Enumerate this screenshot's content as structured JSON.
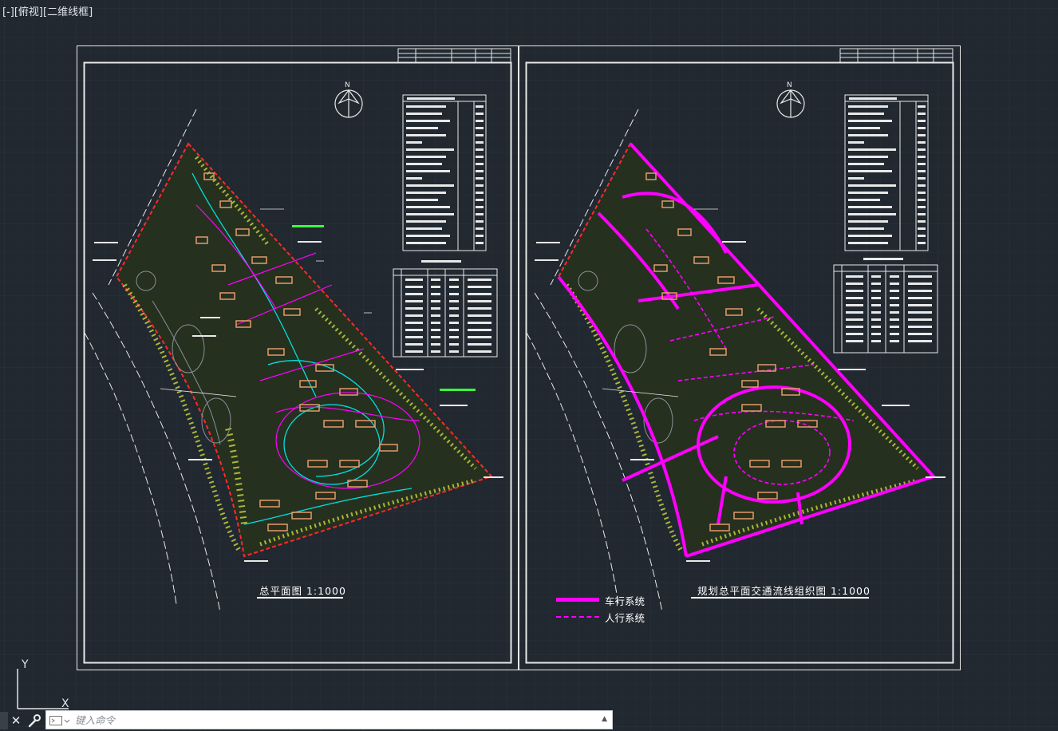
{
  "viewport": {
    "label_parts": [
      "[-]",
      "[俯视]",
      "[二维线框]"
    ]
  },
  "sheets": [
    {
      "title": "总平面图  1:1000"
    },
    {
      "title": "规划总平面交通流线组织图  1:1000"
    }
  ],
  "legend": [
    {
      "label": "车行系统",
      "color": "#ff00ff"
    },
    {
      "label": "人行系统",
      "color": "#ff00ff"
    }
  ],
  "ucs": {
    "y_label": "Y",
    "x_label": "X"
  },
  "command_line": {
    "placeholder": "键入命令",
    "close_glyph": "✕"
  },
  "colors": {
    "background": "#212830",
    "sheet_border": "#e8e8e8",
    "site_boundary": "#ff2a2a",
    "greenery": "#b8c63a",
    "roads": "#ff00ff",
    "buildings": "#e39b6a",
    "paths": "#00e0e0"
  }
}
